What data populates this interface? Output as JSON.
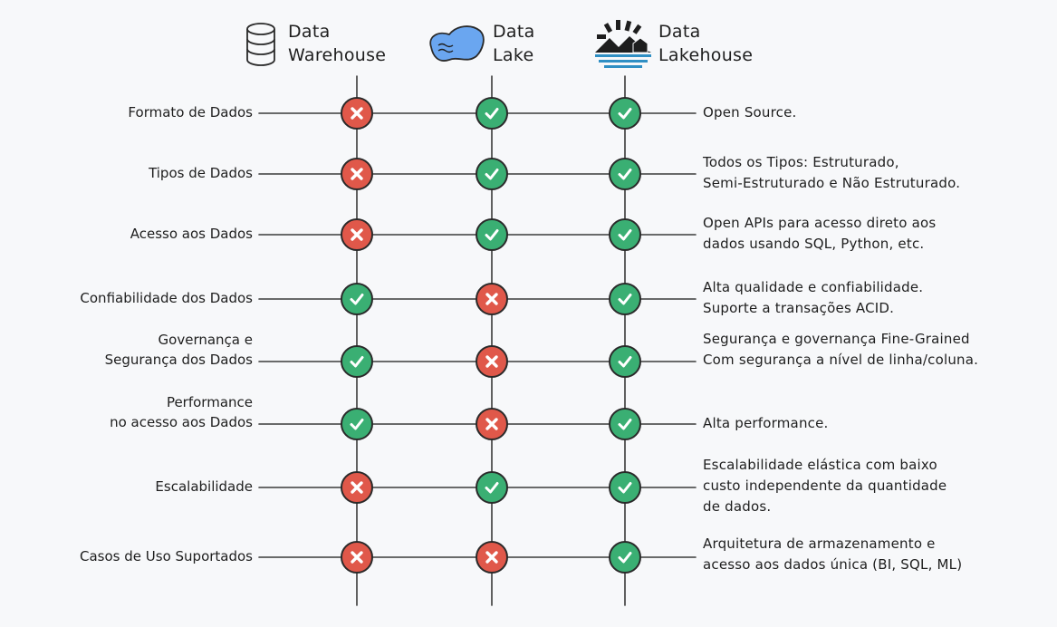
{
  "columns": [
    {
      "id": "dw",
      "title_line1": "Data",
      "title_line2": "Warehouse",
      "icon": "database-icon"
    },
    {
      "id": "dl",
      "title_line1": "Data",
      "title_line2": "Lake",
      "icon": "lake-icon"
    },
    {
      "id": "lh",
      "title_line1": "Data",
      "title_line2": "Lakehouse",
      "icon": "lakehouse-icon"
    }
  ],
  "rows": [
    {
      "feature": [
        "Formato de Dados"
      ],
      "dw": false,
      "dl": true,
      "lh": true,
      "description": [
        "Open Source."
      ]
    },
    {
      "feature": [
        "Tipos de Dados"
      ],
      "dw": false,
      "dl": true,
      "lh": true,
      "description": [
        "Todos os Tipos: Estruturado,",
        "Semi-Estruturado e Não Estruturado."
      ]
    },
    {
      "feature": [
        "Acesso aos Dados"
      ],
      "dw": false,
      "dl": true,
      "lh": true,
      "description": [
        "Open APIs para acesso direto aos",
        "dados usando SQL, Python, etc."
      ]
    },
    {
      "feature": [
        "Confiabilidade dos Dados"
      ],
      "dw": true,
      "dl": false,
      "lh": true,
      "description": [
        "Alta qualidade e confiabilidade.",
        "Suporte a transações ACID."
      ]
    },
    {
      "feature": [
        "Governança e",
        "Segurança dos Dados"
      ],
      "dw": true,
      "dl": false,
      "lh": true,
      "description": [
        "Segurança e governança Fine-Grained",
        "Com segurança a nível de linha/coluna."
      ]
    },
    {
      "feature": [
        "Performance",
        "no acesso aos Dados"
      ],
      "dw": true,
      "dl": false,
      "lh": true,
      "description": [
        "Alta performance."
      ]
    },
    {
      "feature": [
        "Escalabilidade"
      ],
      "dw": false,
      "dl": true,
      "lh": true,
      "description": [
        "Escalabilidade elástica com baixo",
        "custo independente da quantidade",
        "de dados."
      ]
    },
    {
      "feature": [
        "Casos de Uso Suportados"
      ],
      "dw": false,
      "dl": false,
      "lh": true,
      "description": [
        "Arquitetura de armazenamento e",
        "acesso aos dados única (BI, SQL, ML)"
      ]
    }
  ],
  "colors": {
    "yes": "#3aaf73",
    "no": "#e0584a",
    "lake": "#6aa6f0",
    "water": "#2f8fc4"
  }
}
